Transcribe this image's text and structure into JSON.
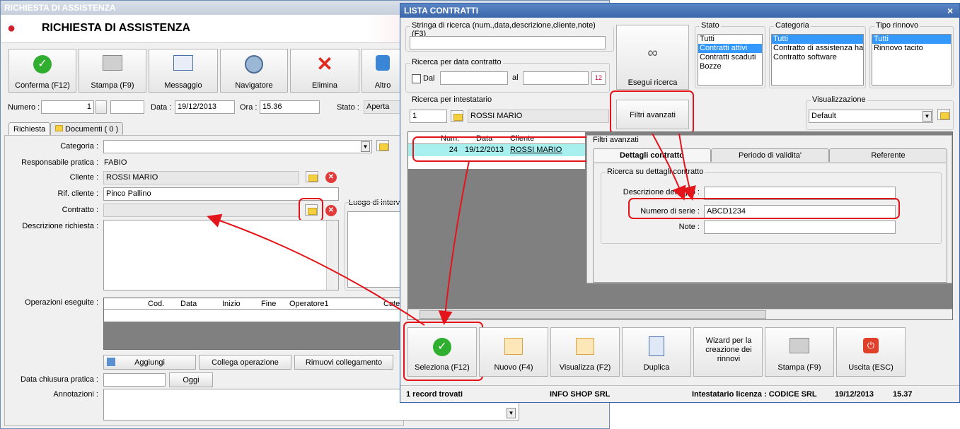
{
  "left": {
    "title_bar": "RICHIESTA DI ASSISTENZA",
    "header_title": "RICHIESTA DI ASSISTENZA",
    "toolbar": [
      "Conferma (F12)",
      "Stampa (F9)",
      "Messaggio",
      "Navigatore",
      "Elimina",
      "Altro"
    ],
    "numero_label": "Numero :",
    "numero_value": "1",
    "data_label": "Data :",
    "data_value": "19/12/2013",
    "ora_label": "Ora :",
    "ora_value": "15.36",
    "stato_label": "Stato :",
    "stato_value": "Aperta",
    "tabs": [
      "Richiesta",
      "Documenti ( 0 )"
    ],
    "categoria_label": "Categoria :",
    "responsabile_label": "Responsabile pratica :",
    "responsabile_value": "FABIO",
    "cliente_label": "Cliente :",
    "cliente_value": "ROSSI MARIO",
    "rif_label": "Rif. cliente :",
    "rif_value": "Pinco Pallino",
    "contratto_label": "Contratto :",
    "luogo_label": "Luogo di interve",
    "descrizione_label": "Descrizione richiesta :",
    "operazioni_label": "Operazioni eseguite :",
    "op_columns": [
      "Cod.",
      "Data",
      "Inizio",
      "Fine",
      "Operatore1",
      "Categ"
    ],
    "aggiungi": "Aggiungi",
    "collega": "Collega operazione",
    "rimuovi": "Rimuovi collegamento",
    "chiusura_label": "Data chiusura pratica :",
    "oggi": "Oggi",
    "annotazioni_label": "Annotazioni :"
  },
  "right": {
    "title_bar": "LISTA CONTRATTI",
    "close": "×",
    "stringa_caption": "Stringa di ricerca (num.,data,descrizione,cliente,note) (F3)",
    "data_caption": "Ricerca per data contratto",
    "dal": "Dal",
    "al": "al",
    "intestatario_caption": "Ricerca per intestatario",
    "intestatario_code": "1",
    "intestatario_name": "ROSSI MARIO",
    "esegui": "Esegui ricerca",
    "filtri": "Filtri avanzati",
    "stato_caption": "Stato",
    "stato_items": [
      "Tutti",
      "Contratti attivi",
      "Contratti scaduti",
      "Bozze"
    ],
    "stato_selected": "Contratti attivi",
    "categoria_caption": "Categoria",
    "categoria_items": [
      "Tutti",
      "Contratto di assistenza ha",
      "Contratto software"
    ],
    "categoria_selected": "Tutti",
    "rinnovo_caption": "Tipo rinnovo",
    "rinnovo_items": [
      "Tutti",
      "Rinnovo tacito"
    ],
    "rinnovo_selected": "Tutti",
    "visualizzazione_caption": "Visualizzazione",
    "visualizzazione_value": "Default",
    "grid_columns": [
      "Num.",
      "Data",
      "Cliente"
    ],
    "grid_row": {
      "num": "24",
      "data": "19/12/2013",
      "cliente": "ROSSI MARIO"
    },
    "filtri_panel_caption": "Filtri avanzati",
    "filter_tabs": [
      "Dettagli contratto",
      "Periodo di validita'",
      "Referente"
    ],
    "dettagli_caption": "Ricerca su dettagli contratto",
    "descrizione_dettaglio_label": "Descrizione dettaglio :",
    "numero_serie_label": "Numero di serie :",
    "numero_serie_value": "ABCD1234",
    "note_label": "Note :",
    "bottom_buttons": [
      "Seleziona (F12)",
      "Nuovo (F4)",
      "Visualizza (F2)",
      "Duplica",
      "Wizard per la creazione dei rinnovi",
      "Stampa (F9)",
      "Uscita (ESC)"
    ],
    "status": {
      "records": "1 record trovati",
      "company": "INFO SHOP SRL",
      "license": "Intestatario licenza : CODICE SRL",
      "date": "19/12/2013",
      "time": "15.37"
    }
  }
}
